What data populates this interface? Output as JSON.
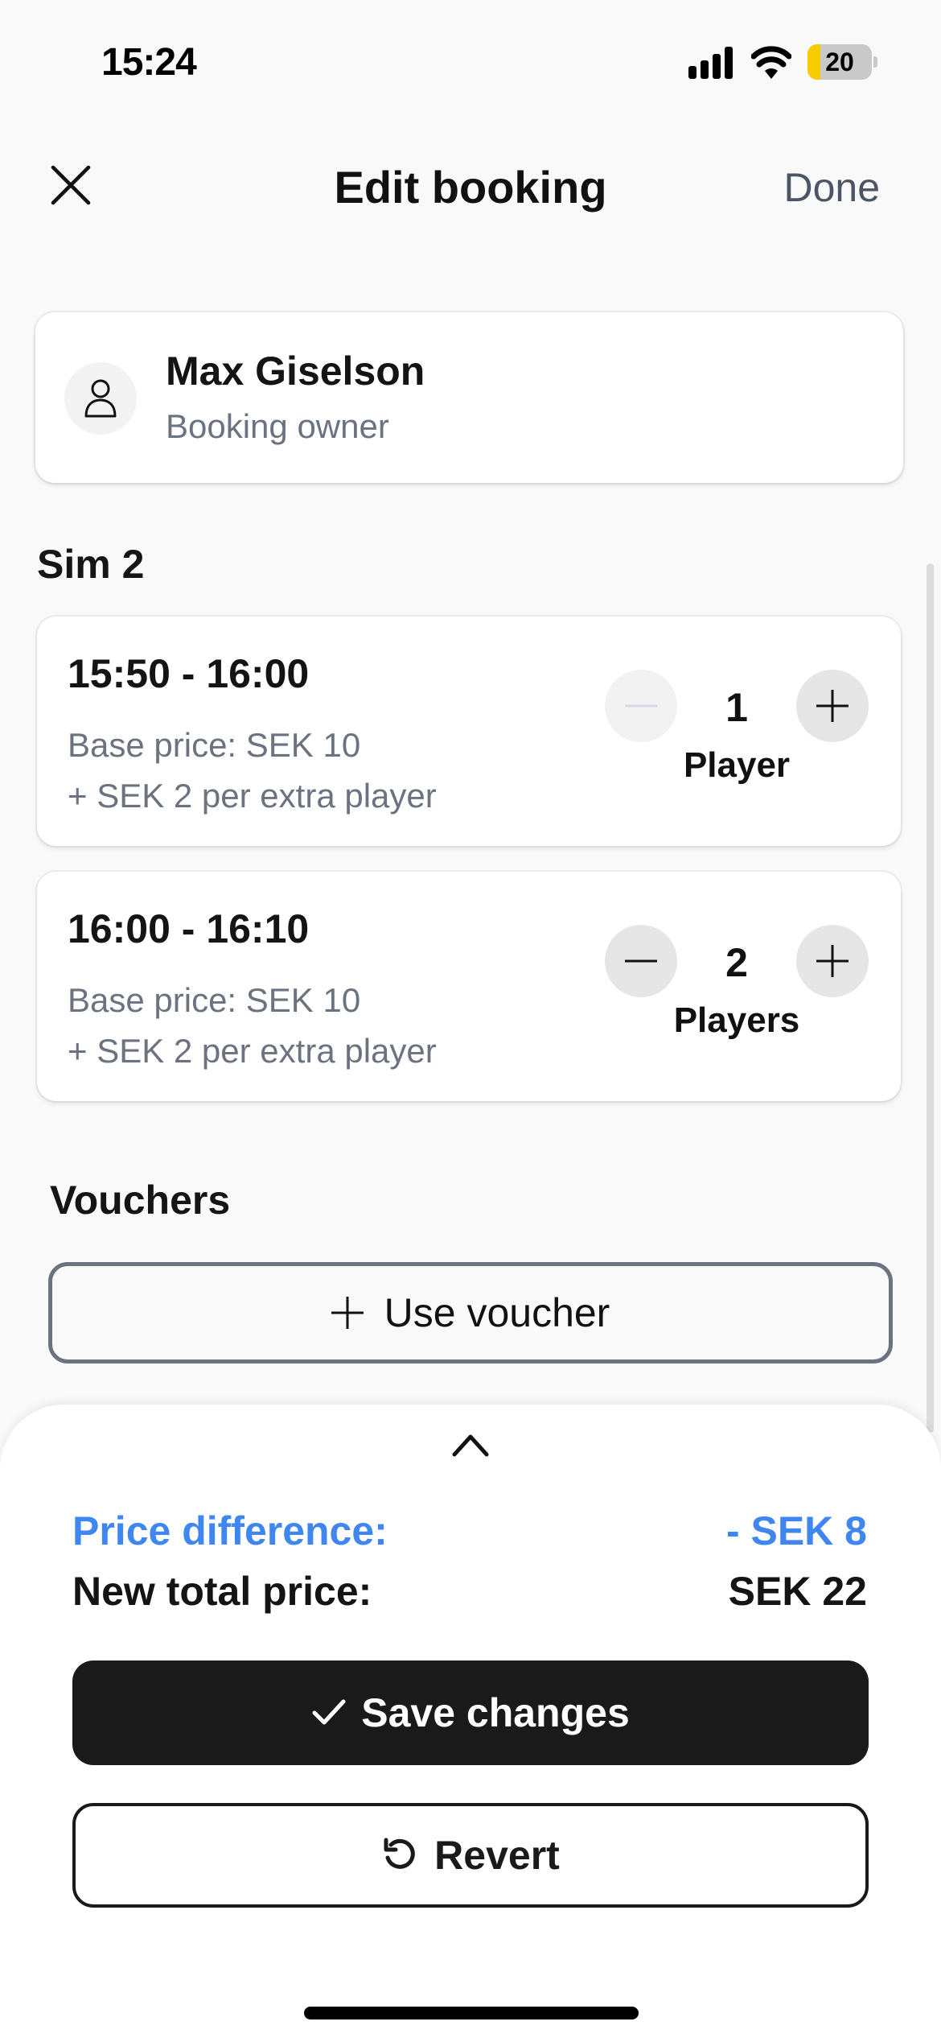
{
  "status_bar": {
    "time": "15:24",
    "battery_level": "20",
    "battery_fraction": 0.2,
    "signal_bars": 4,
    "icons": [
      "cellular-signal-icon",
      "wifi-icon",
      "battery-icon"
    ]
  },
  "nav": {
    "close_icon": "close-icon",
    "title": "Edit booking",
    "done_label": "Done"
  },
  "owner": {
    "avatar_icon": "user-icon",
    "name": "Max Giselson",
    "role": "Booking owner"
  },
  "sim": {
    "title": "Sim 2",
    "slots": [
      {
        "time": "15:50 - 16:00",
        "base_price": "Base price: SEK 10",
        "extra_price": "+ SEK 2 per extra player",
        "players": "1",
        "players_label": "Player",
        "decrement_enabled": false,
        "increment_enabled": true
      },
      {
        "time": "16:00 - 16:10",
        "base_price": "Base price: SEK 10",
        "extra_price": "+ SEK 2 per extra player",
        "players": "2",
        "players_label": "Players",
        "decrement_enabled": true,
        "increment_enabled": true
      }
    ]
  },
  "vouchers": {
    "title": "Vouchers",
    "use_voucher_label": "Use voucher"
  },
  "summary": {
    "price_difference_label": "Price difference:",
    "price_difference_value": "- SEK 8",
    "new_total_label": "New total price:",
    "new_total_value": "SEK 22",
    "save_label": "Save changes",
    "revert_label": "Revert",
    "accent_color": "#3f86f0"
  }
}
